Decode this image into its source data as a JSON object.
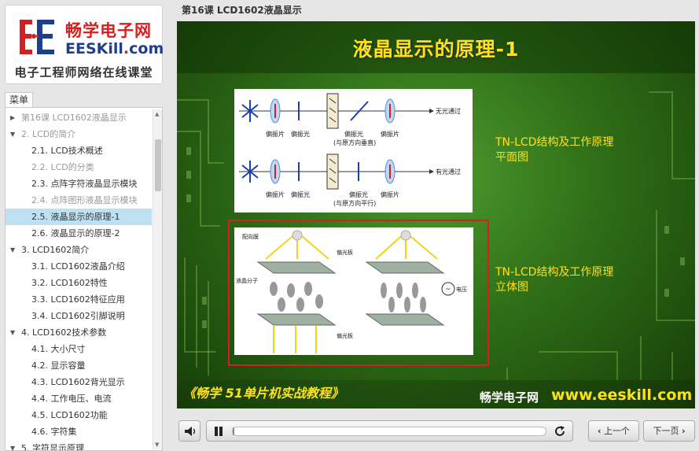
{
  "brand": {
    "title": "畅学电子网",
    "site_prefix": "EESKill",
    "site_dot": ".",
    "site_suffix": "com",
    "tagline": "电子工程师网络在线课堂",
    "colors": {
      "red": "#d42020",
      "blue": "#1c3f8e"
    }
  },
  "menu": {
    "tab_label": "菜单",
    "items": [
      {
        "label": "第16课   LCD1602液晶显示",
        "level": 1,
        "arrow": "right",
        "dim": true
      },
      {
        "label": "2. LCD的简介",
        "level": 1,
        "arrow": "down",
        "dim": true
      },
      {
        "label": "2.1. LCD技术概述",
        "level": 2
      },
      {
        "label": "2.2. LCD的分类",
        "level": 2,
        "dim": true
      },
      {
        "label": "2.3. 点阵字符液晶显示模块",
        "level": 2
      },
      {
        "label": "2.4. 点阵图形液晶显示模块",
        "level": 2,
        "dim": true
      },
      {
        "label": "2.5. 液晶显示的原理-1",
        "level": 2,
        "active": true
      },
      {
        "label": "2.6. 液晶显示的原理-2",
        "level": 2
      },
      {
        "label": "3. LCD1602简介",
        "level": 1,
        "arrow": "down"
      },
      {
        "label": "3.1. LCD1602液晶介绍",
        "level": 2
      },
      {
        "label": "3.2. LCD1602特性",
        "level": 2
      },
      {
        "label": "3.3. LCD1602特征应用",
        "level": 2
      },
      {
        "label": "3.4. LCD1602引脚说明",
        "level": 2
      },
      {
        "label": "4. LCD1602技术参数",
        "level": 1,
        "arrow": "down"
      },
      {
        "label": "4.1. 大小尺寸",
        "level": 2
      },
      {
        "label": "4.2. 显示容量",
        "level": 2
      },
      {
        "label": "4.3. LCD1602背光显示",
        "level": 2
      },
      {
        "label": "4.4. 工作电压、电流",
        "level": 2
      },
      {
        "label": "4.5. LCD1602功能",
        "level": 2
      },
      {
        "label": "4.6. 字符集",
        "level": 2
      },
      {
        "label": "5. 字符显示原理",
        "level": 1,
        "arrow": "down"
      }
    ]
  },
  "header": {
    "lesson_title": "第16课   LCD1602液晶显示"
  },
  "slide": {
    "title": "液晶显示的原理-1",
    "top_diagram": {
      "row1_right": "无光通过",
      "row2_right": "有光通过",
      "labels_row1": [
        "偏振片",
        "偏振光",
        "偏振光",
        "偏振片"
      ],
      "note_row1": "(与原方向垂直)",
      "labels_row2": [
        "偏振片",
        "偏振光",
        "偏振光",
        "偏振片"
      ],
      "note_row2": "(与原方向平行)"
    },
    "bottom_diagram": {
      "label_align": "配向膜",
      "label_polarizer_top": "偏光板",
      "label_polarizer_bottom": "偏光板",
      "label_molecule": "液晶分子",
      "label_voltage": "电压"
    },
    "caption1_line1": "TN-LCD结构及工作原理",
    "caption1_line2": "平面图",
    "caption2_line1": "TN-LCD结构及工作原理",
    "caption2_line2": "立体图",
    "footer_left": "《畅学 51单片机实战教程》",
    "footer_brand": "畅学电子网",
    "footer_url": "www.eeskill.com",
    "colors": {
      "title": "#ffe11a",
      "highlight_frame": "#d61e1e"
    }
  },
  "controls": {
    "prev_label": "上一个",
    "next_label": "下一页",
    "progress": 0.003
  }
}
